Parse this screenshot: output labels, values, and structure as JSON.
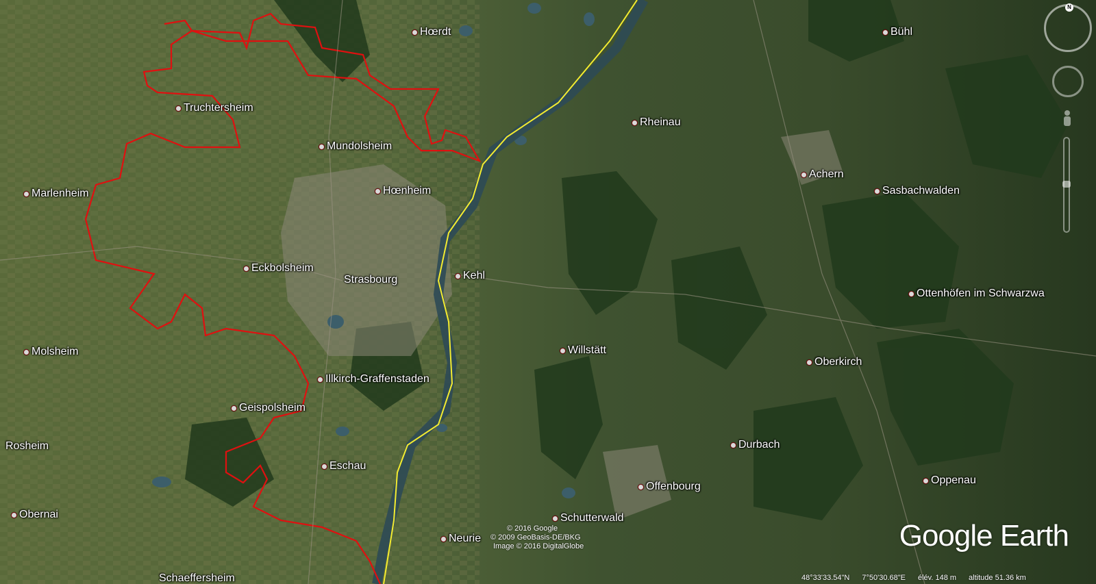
{
  "map": {
    "places": [
      {
        "id": "hoerdt",
        "label": "Hœrdt"
      },
      {
        "id": "buehl",
        "label": "Bühl"
      },
      {
        "id": "truchtersheim",
        "label": "Truchtersheim"
      },
      {
        "id": "rheinau",
        "label": "Rheinau"
      },
      {
        "id": "mundolsheim",
        "label": "Mundolsheim"
      },
      {
        "id": "achern",
        "label": "Achern"
      },
      {
        "id": "hoenheim",
        "label": "Hœnheim"
      },
      {
        "id": "sasbachwalden",
        "label": "Sasbachwalden"
      },
      {
        "id": "marlenheim",
        "label": "Marlenheim"
      },
      {
        "id": "eckbolsheim",
        "label": "Eckbolsheim"
      },
      {
        "id": "strasbourg",
        "label": "Strasbourg"
      },
      {
        "id": "kehl",
        "label": "Kehl"
      },
      {
        "id": "ottenhoefen",
        "label": "Ottenhöfen im Schwarzwa"
      },
      {
        "id": "molsheim",
        "label": "Molsheim"
      },
      {
        "id": "willstaett",
        "label": "Willstätt"
      },
      {
        "id": "oberkirch",
        "label": "Oberkirch"
      },
      {
        "id": "illkirch",
        "label": "Illkirch-Graffenstaden"
      },
      {
        "id": "geispolsheim",
        "label": "Geispolsheim"
      },
      {
        "id": "rosheim",
        "label": "Rosheim"
      },
      {
        "id": "durbach",
        "label": "Durbach"
      },
      {
        "id": "eschau",
        "label": "Eschau"
      },
      {
        "id": "oppenau",
        "label": "Oppenau"
      },
      {
        "id": "offenbourg",
        "label": "Offenbourg"
      },
      {
        "id": "obernai",
        "label": "Obernai"
      },
      {
        "id": "schutterwald",
        "label": "Schutterwald"
      },
      {
        "id": "neuried",
        "label": "Neurie"
      },
      {
        "id": "schaeffersheim",
        "label": "Schaeffersheim"
      }
    ],
    "colors": {
      "boundary": "#e01010",
      "river_line": "#f4ec30",
      "water": "#3c5e6a"
    }
  },
  "credits": {
    "line1": "© 2016 Google",
    "line2": "© 2009 GeoBasis-DE/BKG",
    "line3": "Image © 2016 DigitalGlobe"
  },
  "logo": {
    "text": "Google Earth"
  },
  "status": {
    "lat": "48°33'33.54\"N",
    "lon": "7°50'30.68\"E",
    "elev": "élév.  148 m",
    "alt": "altitude  51.36 km"
  },
  "nav": {
    "compass_icon": "compass-icon",
    "north": "N"
  }
}
